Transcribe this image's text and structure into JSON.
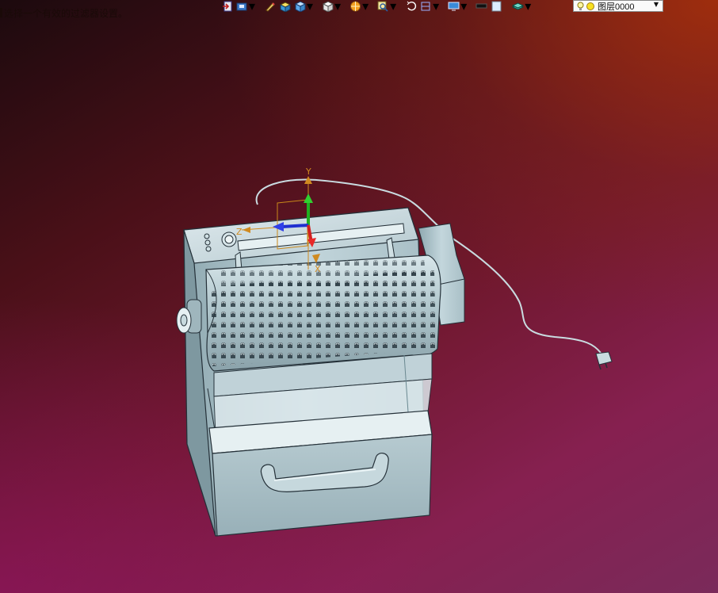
{
  "status": {
    "prompt_text": "选择一个有效的过滤器设置。"
  },
  "toolbar": {
    "icons": [
      "exit-icon",
      "tools-icon",
      "pencil-icon",
      "box-yellow-icon",
      "cube-blue-icon",
      "cube-white-icon",
      "sphere-orange-icon",
      "zoom-icon",
      "rotate-icon",
      "section-icon",
      "display-icon",
      "black-rect-icon",
      "white-rect-icon",
      "layer-stack-icon"
    ],
    "layer_combo": {
      "value": "图层0000"
    }
  },
  "viewport": {
    "triad": {
      "y_label": "Y",
      "z_label": "Z",
      "x_label": "X"
    },
    "model_colors": {
      "body": "#b8ccd2",
      "shadow": "#7e98a0",
      "highlight": "#e6f0f2",
      "edge": "#243038"
    }
  }
}
